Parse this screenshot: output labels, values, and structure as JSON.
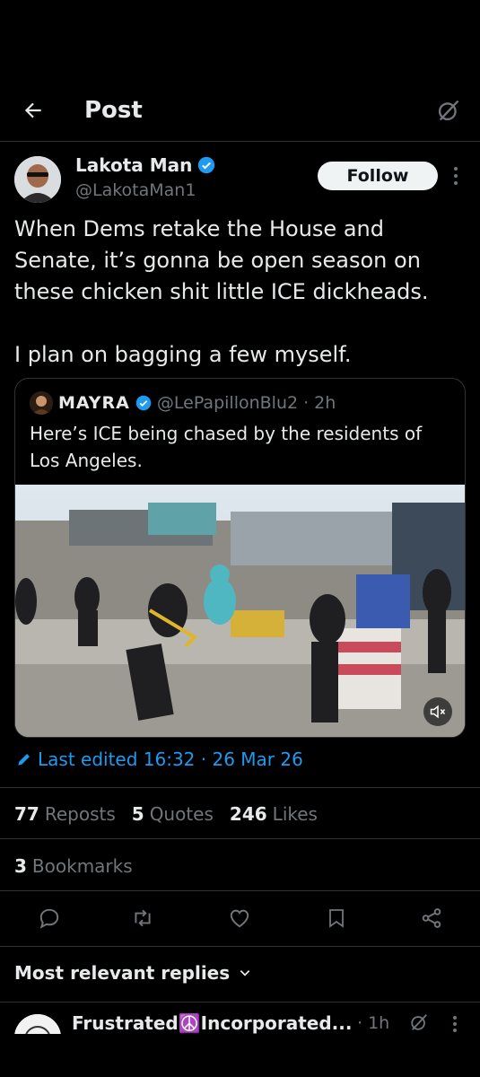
{
  "header": {
    "title": "Post",
    "back_icon": "arrow-left-icon",
    "grok_icon": "grok-icon"
  },
  "post": {
    "author_name": "Lakota Man",
    "author_handle": "@LakotaMan1",
    "verified": true,
    "follow_label": "Follow",
    "text": "When Dems retake the House and Senate, it’s gonna be open season on these chicken shit little ICE dickheads.\n\nI plan on bagging a few myself."
  },
  "quote": {
    "name": "MAYRA",
    "handle": "@LePapillonBlu2",
    "time": "· 2h",
    "text": "Here’s ICE being chased by the residents of Los Angeles."
  },
  "edited": {
    "label": "Last edited 16:32 · 26 Mar 26"
  },
  "stats": {
    "reposts_count": "77",
    "reposts_label": "Reposts",
    "quotes_count": "5",
    "quotes_label": "Quotes",
    "likes_count": "246",
    "likes_label": "Likes",
    "bookmarks_count": "3",
    "bookmarks_label": "Bookmarks"
  },
  "actions": [
    "reply-icon",
    "repost-icon",
    "like-icon",
    "bookmark-icon",
    "share-icon"
  ],
  "replies": {
    "sort_label": "Most relevant replies"
  },
  "reply": {
    "name": "Frustrated☮️Incorporated...",
    "time": "· 1h"
  },
  "colors": {
    "accent": "#1d9bf0",
    "background": "#000000",
    "muted": "#71767b",
    "text": "#e7e9ea"
  }
}
